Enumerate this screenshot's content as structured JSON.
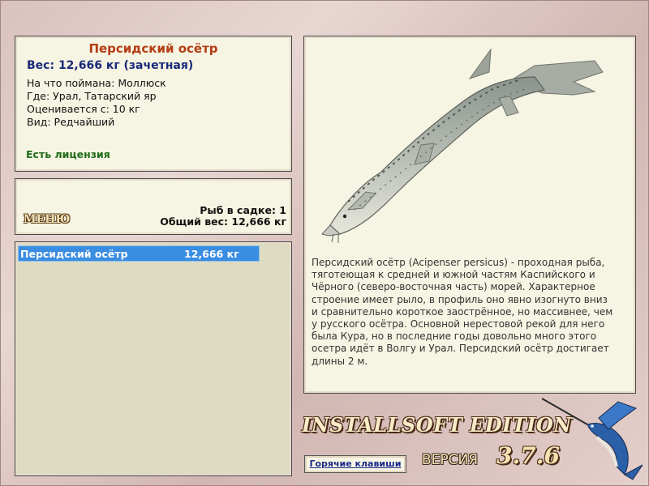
{
  "fish_info": {
    "title": "Персидский осётр",
    "weight": "Вес: 12,666 кг (зачетная)",
    "caught_on": "На что поймана: Моллюск",
    "where": "Где: Урал, Татарский яр",
    "rated_from": "Оценивается с: 10 кг",
    "kind": "Вид: Редчайший",
    "license": "Есть лицензия"
  },
  "cage": {
    "menu_label": "МЕНЮ",
    "count": "Рыб в садке: 1",
    "total_weight": "Общий вес: 12,666 кг"
  },
  "catch_list": [
    {
      "name": "Персидский осётр",
      "weight": "12,666 кг"
    }
  ],
  "fish_image": {
    "icon": "sturgeon-illustration"
  },
  "description": "Персидский осётр (Acipenser persicus) - проходная рыба, тяготеющая к средней и южной частям Каспийского и Чёрного (северо-восточная часть) морей. Характерное строение имеет рыло, в профиль оно явно изогнуто вниз и сравнительно короткое заострённое, но массивнее, чем у русского осётра. Основной нерестовой рекой для него была Кура, но в последние годы довольно много этого осетра идёт в Волгу и Урал. Персидский осётр достигает длины 2 м.",
  "branding": {
    "edition": "INSTALLSOFT EDITION",
    "version_label": "ВЕРСИЯ",
    "version_number": "3.7.6",
    "logo_icon": "marlin-logo"
  },
  "hotkeys_label": "Горячие клавиши",
  "colors": {
    "title": "#b43c13",
    "weight": "#1a2a7a",
    "license": "#1f6b17",
    "selection": "#3a8de0",
    "panel": "#f6f4e2"
  }
}
